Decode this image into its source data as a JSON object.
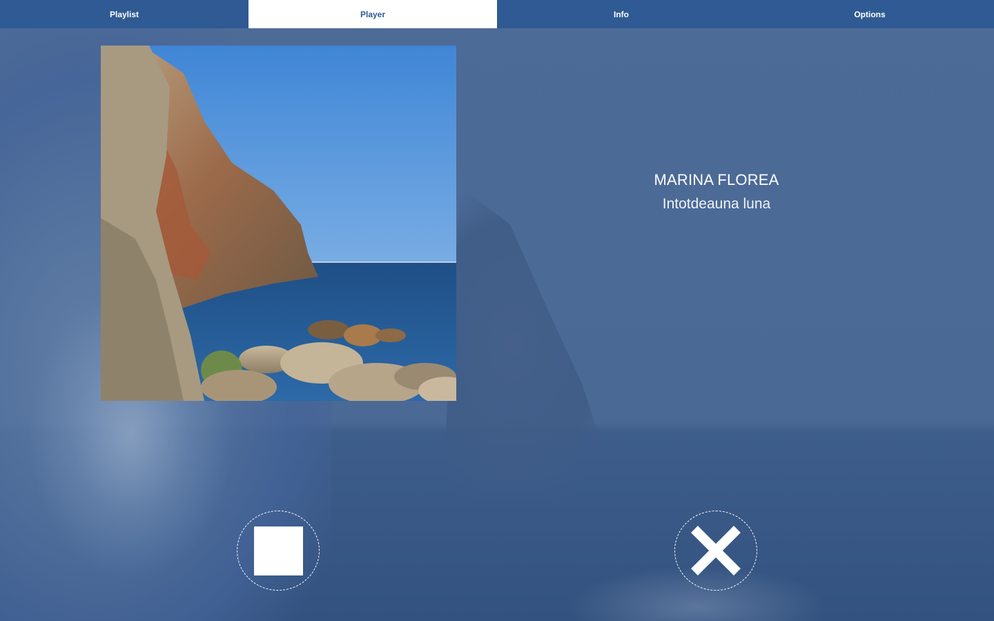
{
  "tabs": [
    {
      "label": "Playlist",
      "active": false
    },
    {
      "label": "Player",
      "active": true
    },
    {
      "label": "Info",
      "active": false
    },
    {
      "label": "Options",
      "active": false
    }
  ],
  "track": {
    "artist": "MARINA FLOREA",
    "title": "Intotdeauna luna"
  },
  "controls": {
    "stop_icon": "stop-icon",
    "close_icon": "close-icon"
  },
  "colors": {
    "tab_bar": "#2f5a93",
    "tab_active_bg": "#ffffff",
    "overlay": "#4a6994",
    "text": "#ffffff"
  }
}
